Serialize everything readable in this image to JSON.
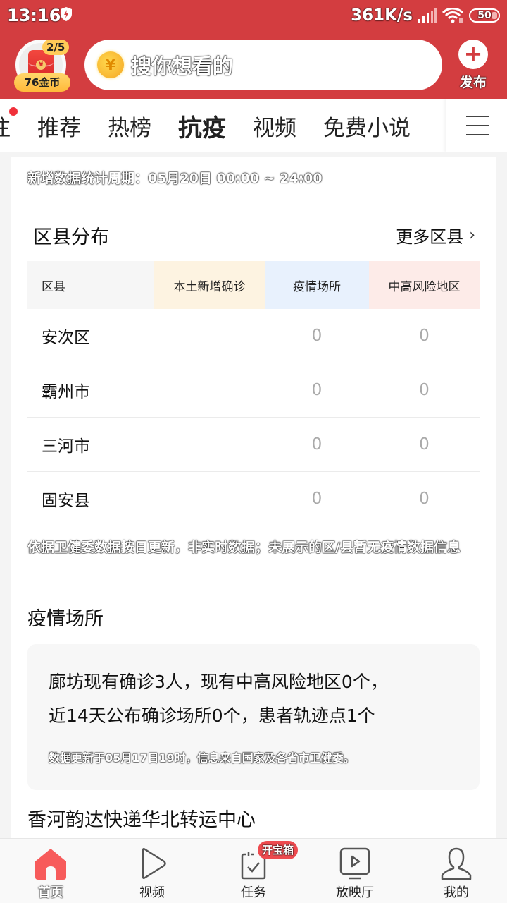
{
  "status_bar": {
    "time": "13:16",
    "network_speed": "361K/s",
    "battery": "50"
  },
  "header": {
    "task_progress": "2/5",
    "coins": "76金币",
    "envelope_symbol": "¥",
    "coin_symbol": "¥",
    "search_placeholder": "搜你想看的",
    "publish_label": "发布",
    "publish_symbol": "+"
  },
  "tabs": [
    {
      "label": "关注",
      "visible_label": "注",
      "has_dot": true
    },
    {
      "label": "推荐"
    },
    {
      "label": "热榜"
    },
    {
      "label": "抗疫",
      "active": true
    },
    {
      "label": "视频"
    },
    {
      "label": "免费小说"
    }
  ],
  "content": {
    "period": "新增数据统计周期：05月20日 00:00 ~ 24:00",
    "district_section": {
      "title": "区县分布",
      "more_label": "更多区县",
      "more_chevron": "›",
      "headers": [
        "区县",
        "本土新增确诊",
        "疫情场所",
        "中高风险地区"
      ],
      "header_colors": [
        "#f6f6f6",
        "#fdf3e1",
        "#e8f1fd",
        "#fdebe8"
      ],
      "rows": [
        {
          "district": "安次区",
          "new_local_confirmed": "",
          "epidemic_sites": "0",
          "risk_areas": "0"
        },
        {
          "district": "霸州市",
          "new_local_confirmed": "",
          "epidemic_sites": "0",
          "risk_areas": "0"
        },
        {
          "district": "三河市",
          "new_local_confirmed": "",
          "epidemic_sites": "0",
          "risk_areas": "0"
        },
        {
          "district": "固安县",
          "new_local_confirmed": "",
          "epidemic_sites": "0",
          "risk_areas": "0"
        }
      ],
      "note": "依据卫健委数据按日更新，非实时数据；未展示的区/县暂无疫情数据信息"
    },
    "sites_section": {
      "title": "疫情场所",
      "summary_line1": "廊坊现有确诊3人，现有中高风险地区0个，",
      "summary_line2": "近14天公布确诊场所0个，患者轨迹点1个",
      "update_note": "数据更新于05月17日19时，信息来自国家及各省市卫健委。",
      "first_place": "香河韵达快递华北转运中心"
    }
  },
  "bottom_nav": {
    "items": [
      {
        "label": "首页",
        "icon": "home-icon",
        "active": true
      },
      {
        "label": "视频",
        "icon": "play-icon"
      },
      {
        "label": "任务",
        "icon": "task-icon"
      },
      {
        "label": "放映厅",
        "icon": "theater-icon"
      },
      {
        "label": "我的",
        "icon": "profile-icon"
      }
    ],
    "task_badge": "开宝箱"
  },
  "colors": {
    "brand_red": "#d33d40",
    "active_nav": "#f75b5b",
    "badge_red": "#ed4a4f"
  }
}
